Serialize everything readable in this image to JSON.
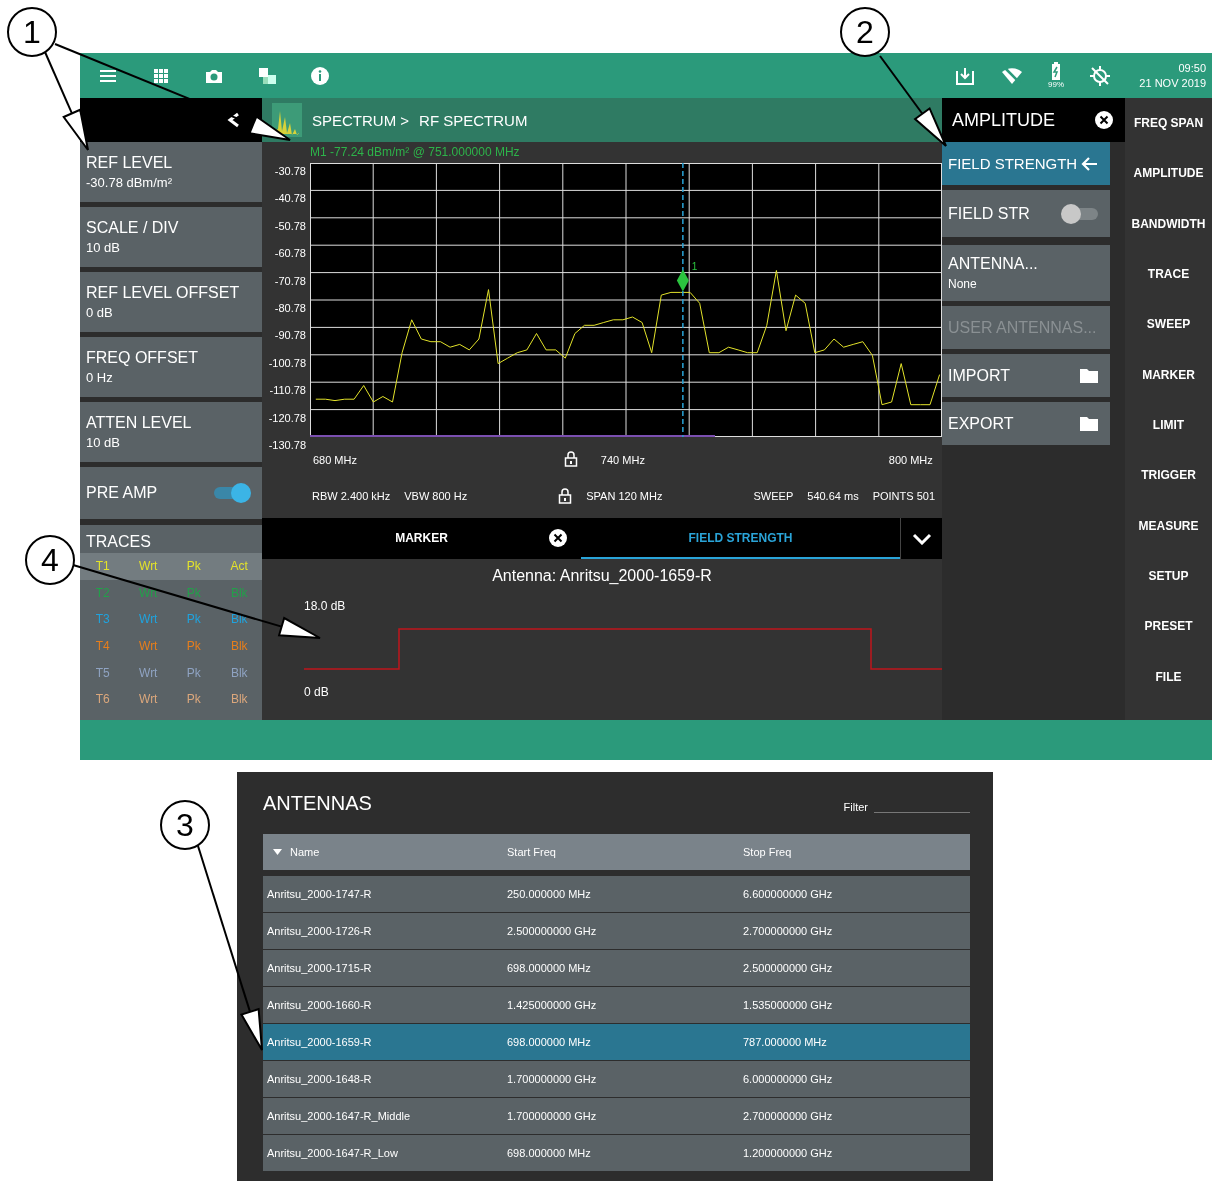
{
  "callouts": [
    {
      "label": "1"
    },
    {
      "label": "2"
    },
    {
      "label": "3"
    },
    {
      "label": "4"
    }
  ],
  "top_bar": {
    "battery": "99%",
    "time": "09:50",
    "date": "21 NOV 2019"
  },
  "left_panel": {
    "settings": [
      {
        "kind": "value",
        "label": "REF LEVEL",
        "value": "-30.78 dBm/m²"
      },
      {
        "kind": "value",
        "label": "SCALE / DIV",
        "value": "10 dB"
      },
      {
        "kind": "value",
        "label": "REF LEVEL OFFSET",
        "value": "0 dB"
      },
      {
        "kind": "value",
        "label": "FREQ OFFSET",
        "value": "0 Hz"
      },
      {
        "kind": "value",
        "label": "ATTEN LEVEL",
        "value": "10 dB"
      },
      {
        "kind": "toggle",
        "label": "PRE AMP",
        "on": true
      }
    ],
    "traces": {
      "title": "TRACES",
      "rows": [
        {
          "cells": [
            "T1",
            "Wrt",
            "Pk",
            "Act"
          ],
          "color": "#e3e32a",
          "selected": true
        },
        {
          "cells": [
            "T2",
            "Wrt",
            "Pk",
            "Blk"
          ],
          "color": "#22a04a",
          "selected": false
        },
        {
          "cells": [
            "T3",
            "Wrt",
            "Pk",
            "Blk"
          ],
          "color": "#1fa3de",
          "selected": false
        },
        {
          "cells": [
            "T4",
            "Wrt",
            "Pk",
            "Blk"
          ],
          "color": "#e67e1c",
          "selected": false
        },
        {
          "cells": [
            "T5",
            "Wrt",
            "Pk",
            "Blk"
          ],
          "color": "#8fa3c2",
          "selected": false
        },
        {
          "cells": [
            "T6",
            "Wrt",
            "Pk",
            "Blk"
          ],
          "color": "#dba77c",
          "selected": false
        }
      ]
    }
  },
  "header": {
    "crumb": "SPECTRUM >",
    "page": "RF SPECTRUM"
  },
  "spectrum": {
    "marker_readout": "M1   -77.24 dBm/m² @ 751.000000 MHz",
    "chart_data": {
      "type": "line",
      "xlim": [
        674.8,
        806.5
      ],
      "ylim": [
        -130.78,
        -30.78
      ],
      "grid": true,
      "yticks": [
        -30.78,
        -40.78,
        -50.78,
        -60.78,
        -70.78,
        -80.78,
        -90.78,
        -100.78,
        -110.78,
        -120.78,
        -130.78
      ],
      "xticks": [
        {
          "value": 680,
          "label": "680 MHz"
        },
        {
          "value": 740,
          "label": "740 MHz"
        },
        {
          "value": 800,
          "label": "800 MHz"
        }
      ],
      "x": [
        676,
        678,
        680,
        682,
        684,
        686,
        688,
        690,
        692,
        694,
        696,
        698,
        700,
        702,
        704,
        706,
        708,
        710,
        712,
        714,
        716,
        718,
        720,
        722,
        724,
        726,
        728,
        730,
        732,
        734,
        736,
        738,
        740,
        742,
        744,
        746,
        748,
        750,
        752,
        754,
        756,
        758,
        760,
        762,
        764,
        766,
        768,
        770,
        772,
        774,
        776,
        778,
        780,
        782,
        784,
        786,
        788,
        790,
        792,
        794,
        796,
        798,
        800,
        802,
        804,
        806
      ],
      "series": [
        {
          "color": "#e3e32a",
          "values": [
            -117,
            -117,
            -117.5,
            -117,
            -117,
            -112,
            -118,
            -116,
            -118,
            -100,
            -88,
            -95,
            -96,
            -96,
            -98,
            -97,
            -99,
            -95,
            -77,
            -104,
            -102,
            -100,
            -99,
            -93,
            -99,
            -99,
            -102,
            -93,
            -90,
            -90,
            -89,
            -88,
            -88,
            -87,
            -89,
            -100,
            -79,
            -78,
            -78,
            -78,
            -82,
            -100,
            -100,
            -98,
            -99,
            -100,
            -100,
            -90,
            -70,
            -92,
            -79,
            -82,
            -100,
            -99,
            -95,
            -98,
            -97,
            -96,
            -101,
            -119,
            -118,
            -104,
            -119,
            -119,
            -119,
            -108
          ]
        }
      ],
      "ref_lines": [
        {
          "axis": "x",
          "value": 752.5,
          "color": "#2aa4d8"
        }
      ],
      "annotations": [
        "1"
      ]
    },
    "settings_left": [
      "RBW 2.400 kHz",
      "VBW 800 Hz"
    ],
    "span": "SPAN 120 MHz",
    "settings_right": [
      "SWEEP",
      "540.64 ms",
      "POINTS 501"
    ]
  },
  "bottom_tabs": [
    {
      "label": "MARKER",
      "selected": false
    },
    {
      "label": "FIELD STRENGTH",
      "selected": true
    }
  ],
  "antenna_panel": {
    "title": "Antenna: Anritsu_2000-1659-R",
    "y_max": "18.0 dB",
    "y_min": "0 dB"
  },
  "menu": {
    "title": "AMPLITUDE",
    "items": [
      {
        "kind": "header",
        "label": "FIELD STRENGTH",
        "disabled": false
      },
      {
        "kind": "toggle",
        "label": "FIELD STR",
        "on": false,
        "disabled": false
      },
      {
        "kind": "value",
        "label": "ANTENNA...",
        "value": "None",
        "disabled": false
      },
      {
        "kind": "plain",
        "label": "USER ANTENNAS...",
        "disabled": true
      },
      {
        "kind": "folder",
        "label": "IMPORT",
        "disabled": false
      },
      {
        "kind": "folder",
        "label": "EXPORT",
        "disabled": false
      }
    ]
  },
  "nav": [
    "FREQ SPAN",
    "AMPLITUDE",
    "BANDWIDTH",
    "TRACE",
    "SWEEP",
    "MARKER",
    "LIMIT",
    "TRIGGER",
    "MEASURE",
    "SETUP",
    "PRESET",
    "FILE"
  ],
  "antennas": {
    "title": "ANTENNAS",
    "filter_label": "Filter",
    "columns": [
      "Name",
      "Start Freq",
      "Stop Freq"
    ],
    "rows": [
      {
        "cells": [
          "Anritsu_2000-1747-R",
          "250.000000 MHz",
          "6.600000000 GHz"
        ],
        "selected": false
      },
      {
        "cells": [
          "Anritsu_2000-1726-R",
          "2.500000000 GHz",
          "2.700000000 GHz"
        ],
        "selected": false
      },
      {
        "cells": [
          "Anritsu_2000-1715-R",
          "698.000000 MHz",
          "2.500000000 GHz"
        ],
        "selected": false
      },
      {
        "cells": [
          "Anritsu_2000-1660-R",
          "1.425000000 GHz",
          "1.535000000 GHz"
        ],
        "selected": false
      },
      {
        "cells": [
          "Anritsu_2000-1659-R",
          "698.000000 MHz",
          "787.000000 MHz"
        ],
        "selected": true
      },
      {
        "cells": [
          "Anritsu_2000-1648-R",
          "1.700000000 GHz",
          "6.000000000 GHz"
        ],
        "selected": false
      },
      {
        "cells": [
          "Anritsu_2000-1647-R_Middle",
          "1.700000000 GHz",
          "2.700000000 GHz"
        ],
        "selected": false
      },
      {
        "cells": [
          "Anritsu_2000-1647-R_Low",
          "698.000000 MHz",
          "1.200000000 GHz"
        ],
        "selected": false
      }
    ]
  }
}
